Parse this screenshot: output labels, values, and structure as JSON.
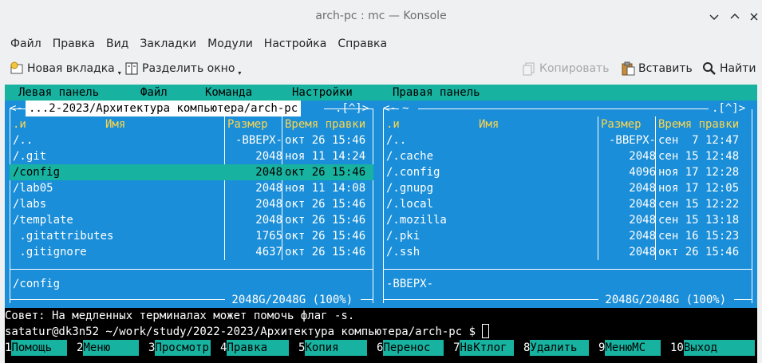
{
  "window": {
    "title": "arch-pc : mc — Konsole"
  },
  "menubar": [
    "Файл",
    "Правка",
    "Вид",
    "Закладки",
    "Модули",
    "Настройка",
    "Справка"
  ],
  "toolbar": {
    "new_tab": "Новая вкладка",
    "split": "Разделить окно",
    "copy": "Копировать",
    "paste": "Вставить",
    "find": "Найти"
  },
  "mc": {
    "menu": [
      "Левая панель",
      "Файл",
      "Команда",
      "Настройки",
      "Правая панель"
    ],
    "left": {
      "path": " ...2-2023/Архитектура компьютера/arch-pc ",
      "corner": ".[^]>",
      "corner_left": "<-",
      "headers": {
        "n": ".и",
        "name": "Имя",
        "size": "Размер",
        "time": "Время правки"
      },
      "rows": [
        {
          "name": "/..",
          "size": "-ВВЕРХ-",
          "time": "окт 26 15:46"
        },
        {
          "name": "/.git",
          "size": "2048",
          "time": "ноя 11 14:24"
        },
        {
          "name": "/config",
          "size": "2048",
          "time": "окт 26 15:46",
          "selected": true
        },
        {
          "name": "/lab05",
          "size": "2048",
          "time": "ноя 11 14:08"
        },
        {
          "name": "/labs",
          "size": "2048",
          "time": "окт 26 15:46"
        },
        {
          "name": "/template",
          "size": "2048",
          "time": "окт 26 15:46"
        },
        {
          "name": " .gitattributes",
          "size": "1765",
          "time": "окт 26 15:46"
        },
        {
          "name": " .gitignore",
          "size": "4637",
          "time": "окт 26 15:46"
        }
      ],
      "status": "/config",
      "free": " 2048G/2048G (100%) "
    },
    "right": {
      "path": " ~ ",
      "corner": ".[^]>",
      "corner_left": "<-",
      "headers": {
        "n": ".и",
        "name": "Имя",
        "size": "Размер",
        "time": "Время правки"
      },
      "rows": [
        {
          "name": "/..",
          "size": "-ВВЕРХ-",
          "time": "сен  7 12:47"
        },
        {
          "name": "/.cache",
          "size": "2048",
          "time": "сен 15 12:48"
        },
        {
          "name": "/.config",
          "size": "4096",
          "time": "ноя 17 12:28"
        },
        {
          "name": "/.gnupg",
          "size": "2048",
          "time": "ноя 17 12:05"
        },
        {
          "name": "/.local",
          "size": "2048",
          "time": "сен 15 12:22"
        },
        {
          "name": "/.mozilla",
          "size": "2048",
          "time": "сен 15 13:18"
        },
        {
          "name": "/.pki",
          "size": "2048",
          "time": "сен 16 15:23"
        },
        {
          "name": "/.ssh",
          "size": "2048",
          "time": "окт 26 15:46"
        }
      ],
      "status": "-ВВЕРХ-",
      "free": " 2048G/2048G (100%) "
    },
    "hint": "Совет: На медленных терминалах может помочь флаг -s.",
    "prompt": "satatur@dk3n52 ~/work/study/2022-2023/Архитектура компьютера/arch-pc $ ",
    "fkeys": [
      {
        "num": " 1",
        "label": "Помощь"
      },
      {
        "num": " 2",
        "label": "Меню"
      },
      {
        "num": " 3",
        "label": "Просмотр"
      },
      {
        "num": " 4",
        "label": "Правка"
      },
      {
        "num": " 5",
        "label": "Копия"
      },
      {
        "num": " 6",
        "label": "Перенос"
      },
      {
        "num": " 7",
        "label": "НвКтлог"
      },
      {
        "num": " 8",
        "label": "Удалить"
      },
      {
        "num": " 9",
        "label": "МенюМС"
      },
      {
        "num": "10",
        "label": "Выход"
      }
    ]
  }
}
